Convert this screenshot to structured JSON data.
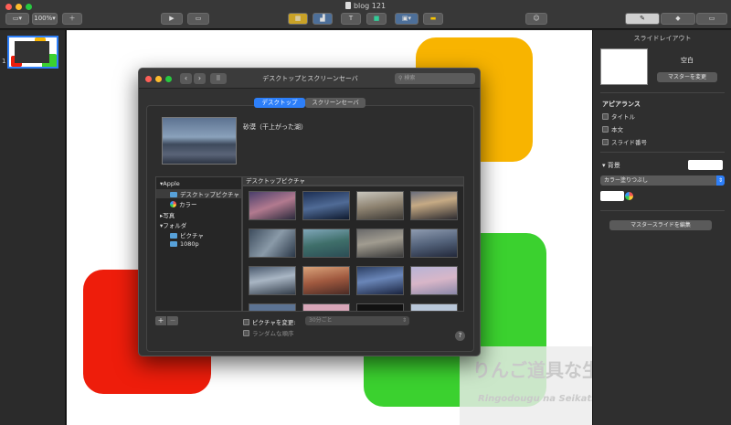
{
  "window": {
    "title": "blog 121",
    "zoom": "100%"
  },
  "inspector": {
    "title": "スライドレイアウト",
    "layout_name": "空白",
    "change_master_label": "マスターを変更",
    "appearance_heading": "アピアランス",
    "options": [
      {
        "label": "タイトル",
        "checked": false
      },
      {
        "label": "本文",
        "checked": false
      },
      {
        "label": "スライド番号",
        "checked": false
      }
    ],
    "background_heading": "背景",
    "fill_type": "カラー塗りつぶし",
    "edit_master_label": "マスタースライドを編集"
  },
  "navigator": {
    "slide_number": "1"
  },
  "watermark": {
    "line1": "りんご道具な生活",
    "line2": "Ringodougu na Seikatsu"
  },
  "dialog": {
    "title": "デスクトップとスクリーンセーバ",
    "search_placeholder": "検索",
    "tabs": [
      {
        "label": "デスクトップ",
        "selected": true
      },
      {
        "label": "スクリーンセーバ",
        "selected": false
      }
    ],
    "current_picture_name": "砂漠（干上がった湖）",
    "sidebar": [
      {
        "label": "Apple",
        "kind": "group-open"
      },
      {
        "label": "デスクトップピクチャ",
        "kind": "folder",
        "selected": true
      },
      {
        "label": "カラー",
        "kind": "color"
      },
      {
        "label": "写真",
        "kind": "group-closed"
      },
      {
        "label": "フォルダ",
        "kind": "group-open"
      },
      {
        "label": "ピクチャ",
        "kind": "folder"
      },
      {
        "label": "1080p",
        "kind": "folder"
      }
    ],
    "grid_header": "デスクトップピクチャ",
    "change_picture_label": "ピクチャを変更:",
    "interval": "30分ごと",
    "random_label": "ランダムな順序",
    "add_label": "+",
    "remove_label": "−",
    "help_label": "?"
  },
  "colors": {
    "accent": "#2d7ff9",
    "yellow_shape": "#f8b400",
    "green_shape": "#3bd12f",
    "red_shape": "#ee1d0b"
  }
}
